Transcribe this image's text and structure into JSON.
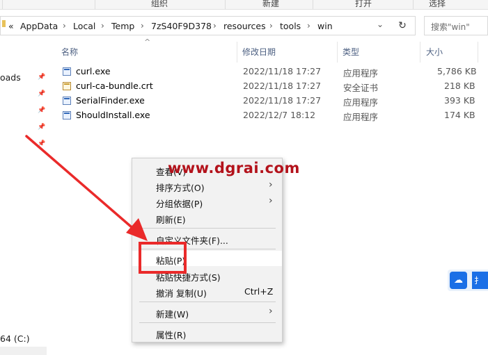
{
  "ribbon": {
    "group_organize": "组织",
    "group_new": "新建",
    "group_open": "打开",
    "group_select": "选择"
  },
  "address": {
    "overflow": "«",
    "crumbs": [
      "AppData",
      "Local",
      "Temp",
      "7zS40F9D378",
      "resources",
      "tools",
      "win"
    ],
    "separator": "›",
    "dropdown": "⌄",
    "refresh": "↻"
  },
  "search": {
    "placeholder": "搜索\"win\""
  },
  "nav": {
    "downloads_fragment": "oads",
    "drive_fragment": "64 (C:)"
  },
  "columns": {
    "name": "名称",
    "modified": "修改日期",
    "type": "类型",
    "size": "大小",
    "sort_indicator": "^"
  },
  "files": [
    {
      "name": "curl.exe",
      "modified": "2022/11/18 17:27",
      "type": "应用程序",
      "size": "5,786 KB",
      "icon": "exe-icon"
    },
    {
      "name": "curl-ca-bundle.crt",
      "modified": "2022/11/18 17:27",
      "type": "安全证书",
      "size": "218 KB",
      "icon": "certificate-icon"
    },
    {
      "name": "SerialFinder.exe",
      "modified": "2022/11/18 17:27",
      "type": "应用程序",
      "size": "393 KB",
      "icon": "exe-icon"
    },
    {
      "name": "ShouldInstall.exe",
      "modified": "2022/12/7 18:12",
      "type": "应用程序",
      "size": "174 KB",
      "icon": "exe-icon"
    }
  ],
  "context_menu": {
    "view": "查看(V)",
    "sort": "排序方式(O)",
    "group": "分组依据(P)",
    "refresh": "刷新(E)",
    "customize": "自定义文件夹(F)...",
    "paste": "粘贴(P)",
    "paste_shortcut": "粘贴快捷方式(S)",
    "undo": "撤消 复制(U)",
    "undo_shortcut": "Ctrl+Z",
    "new": "新建(W)",
    "properties": "属性(R)",
    "submenu_arrow": "›"
  },
  "watermark": "www.dgrai.com",
  "floating": {
    "label_fragment": "扌"
  },
  "colors": {
    "annotation_red": "#ea2a2a",
    "watermark_red": "#b3121b",
    "accent_blue": "#1b6fe6",
    "header_text": "#4d6082"
  }
}
